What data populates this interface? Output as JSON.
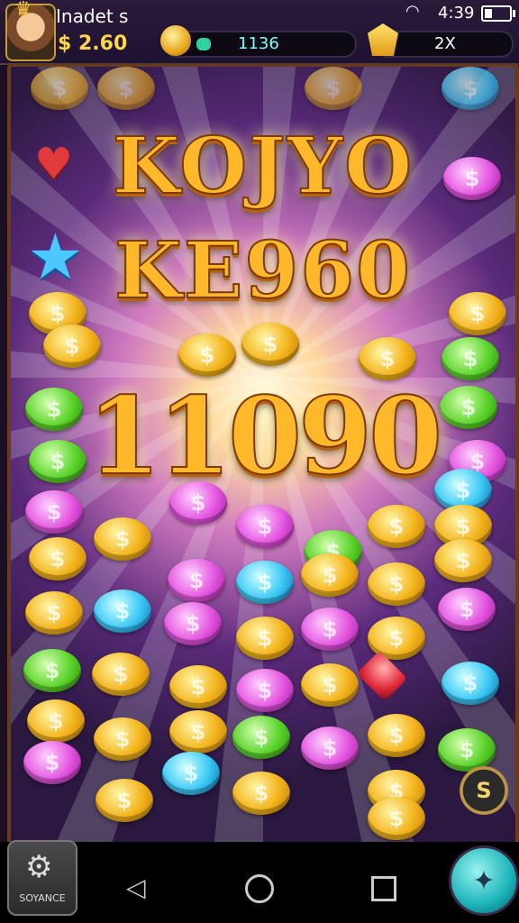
{
  "header": {
    "player_name": "Inadet s",
    "balance": "$ 2.60",
    "time": "4:39",
    "score": "1136",
    "multiplier": "2X"
  },
  "banner": {
    "line1": "KOJYO",
    "line2": "KE960",
    "line3": "11090"
  },
  "board": {
    "special_coin_label": "S"
  },
  "footer": {
    "left_button_label": "SOYANCE"
  },
  "colors": {
    "gold": "#f3b31a",
    "green": "#5ad32a",
    "pink": "#e455e0",
    "blue": "#3ac8f5"
  }
}
